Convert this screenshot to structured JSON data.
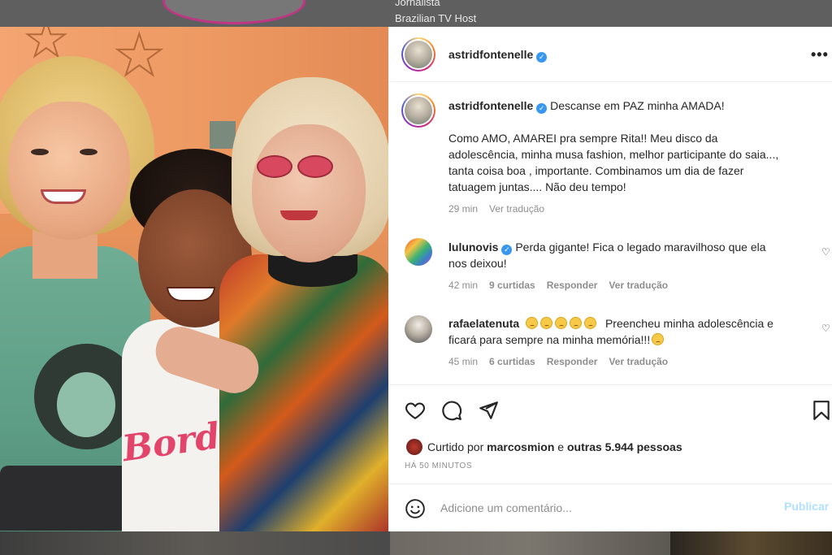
{
  "background": {
    "top_text_line1": "Jornalista",
    "top_text_line2": "Brazilian TV Host"
  },
  "post": {
    "author": "astridfontenelle",
    "verified": true,
    "more_icon": "more-horizontal-icon"
  },
  "caption": {
    "author": "astridfontenelle",
    "line1": "Descanse em PAZ minha AMADA!",
    "body_lines": [
      "Como AMO, AMAREI pra sempre Rita!! Meu disco da",
      "adolescência, minha musa fashion, melhor participante do saia...,",
      "tanta coisa boa , importante. Combinamos um dia de fazer",
      "tatuagem juntas.... Não deu tempo!"
    ],
    "time": "29 min",
    "translate": "Ver tradução"
  },
  "comments": [
    {
      "user": "lulunovis",
      "verified": true,
      "text_line1": "Perda gigante! Fica o legado maravilhoso que ela",
      "text_line2": "nos deixou!",
      "time": "42 min",
      "likes": "9 curtidas",
      "reply": "Responder",
      "translate": "Ver tradução"
    },
    {
      "user": "rafaelatenuta",
      "verified": false,
      "text_line1": "Preencheu minha adolescência e",
      "text_line2": "ficará para sempre na minha memória!!!",
      "emoji_count": 5,
      "time": "45 min",
      "likes": "6 curtidas",
      "reply": "Responder",
      "translate": "Ver tradução"
    }
  ],
  "actions": {
    "icons": [
      "heart-icon",
      "comment-icon",
      "share-icon",
      "bookmark-icon"
    ]
  },
  "likes": {
    "prefix": "Curtido por",
    "user": "marcosmion",
    "connector": "e",
    "others": "outras 5.944 pessoas"
  },
  "time_ago": "HÁ 50 MINUTOS",
  "comment_box": {
    "placeholder": "Adicione um comentário...",
    "publish": "Publicar"
  },
  "colors": {
    "verified": "#3897f0",
    "publish_disabled": "#b2dffc",
    "secondary_text": "#8e8e8e"
  }
}
